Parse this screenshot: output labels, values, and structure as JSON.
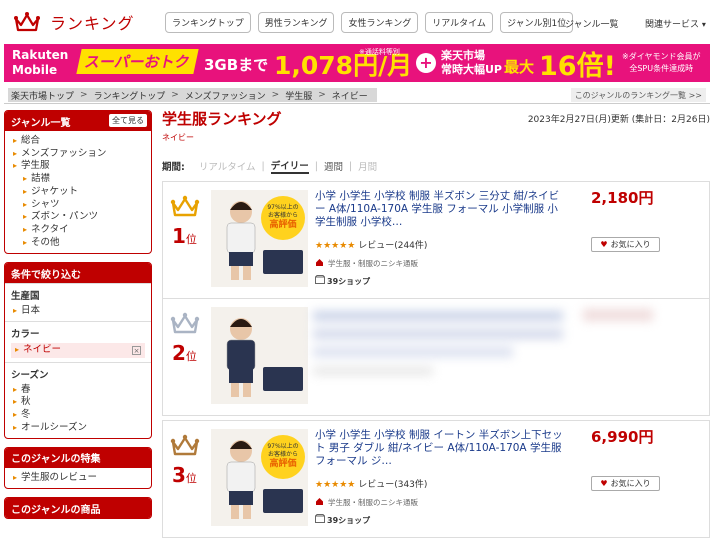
{
  "header": {
    "title": "ランキング",
    "nav": [
      "ランキングトップ",
      "男性ランキング",
      "女性ランキング",
      "リアルタイム",
      "ジャンル別1位"
    ],
    "genre_list": "ジャンル一覧",
    "related": "関連サービス",
    "chev": "▾"
  },
  "banner": {
    "brand_top": "Rakuten",
    "brand_bottom": "Mobile",
    "super": "スーパーおトク",
    "gb": "3GBまで",
    "price": "1,078円/月",
    "note1": "※通話料等別",
    "plus": "+",
    "rk1": "楽天市場",
    "rk2": "常時大幅UP",
    "max": "最大",
    "points": "16倍!",
    "note2a": "※ダイヤモンド会員が",
    "note2b": "全SPU条件達成時"
  },
  "breadcrumb": [
    "楽天市場トップ",
    "ランキングトップ",
    "メンズファッション",
    "学生服",
    "ネイビー"
  ],
  "breadcrumb_sep": ">",
  "genre_rank_link": "このジャンルのランキング一覧 >>",
  "sidebar": {
    "genre": {
      "title": "ジャンル一覧",
      "all": "全て見る",
      "items": [
        {
          "l": "総合",
          "sub": false
        },
        {
          "l": "メンズファッション",
          "sub": false
        },
        {
          "l": "学生服",
          "sub": false
        },
        {
          "l": "詰襟",
          "sub": true
        },
        {
          "l": "ジャケット",
          "sub": true
        },
        {
          "l": "シャツ",
          "sub": true
        },
        {
          "l": "ズボン・パンツ",
          "sub": true
        },
        {
          "l": "ネクタイ",
          "sub": true
        },
        {
          "l": "その他",
          "sub": true
        }
      ]
    },
    "filter": {
      "title": "条件で絞り込む",
      "g1": "生産国",
      "g1items": [
        "日本"
      ],
      "g2": "カラー",
      "g2sel": "ネイビー",
      "g3": "シーズン",
      "g3items": [
        "春",
        "秋",
        "冬",
        "オールシーズン"
      ],
      "x": "×"
    },
    "feature": {
      "title": "このジャンルの特集",
      "items": [
        "学生服のレビュー"
      ]
    },
    "products": {
      "title": "このジャンルの商品"
    }
  },
  "main": {
    "title": "学生服ランキング",
    "subgenre": "ネイビー",
    "date": "2023年2月27日(月)更新 (集計日：2月26日)",
    "period_label": "期間:",
    "periods": [
      "リアルタイム",
      "デイリー",
      "週間",
      "月間"
    ],
    "period_sep": "|",
    "rank_suffix": "位",
    "items": [
      {
        "rank": "1",
        "name": "小学 小学生 小学校 制服 半ズボン 三分丈 紺/ネイビー A体/110A-170A 学生服 フォーマル 小学制服 小学生制服 小学校…",
        "stars": "★★★★★",
        "review": "レビュー(244件)",
        "shop": "学生服・制服のニシキ通販",
        "shops": "39ショップ",
        "price": "2,180円",
        "fav": "お気に入り",
        "color": "#e8a200"
      },
      {
        "rank": "2",
        "name": "",
        "stars": "",
        "review": "",
        "shop": "",
        "shops": "",
        "price": "",
        "fav": "",
        "color": "#aab4c4"
      },
      {
        "rank": "3",
        "name": "小学 小学生 小学校 制服 イートン 半ズボン上下セット 男子 ダブル 紺/ネイビー A体/110A-170A 学生服 フォーマル ジ…",
        "stars": "★★★★★",
        "review": "レビュー(343件)",
        "shop": "学生服・制服のニシキ通販",
        "shops": "39ショップ",
        "price": "6,990円",
        "fav": "お気に入り",
        "color": "#b07a3a"
      }
    ],
    "badge": {
      "l1": "97%以上の",
      "l2": "お客様から",
      "l3": "高評価"
    }
  }
}
